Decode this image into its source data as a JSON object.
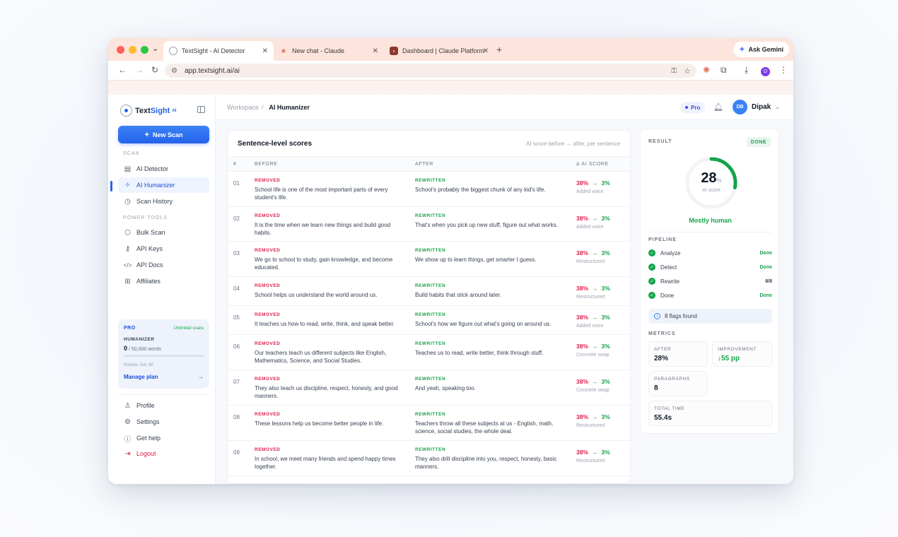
{
  "browser": {
    "tabs": [
      {
        "title": "TextSight - AI Detector",
        "icon": "textsight-icon"
      },
      {
        "title": "New chat - Claude",
        "icon": "claude-icon"
      },
      {
        "title": "Dashboard | Claude Platform",
        "icon": "anthropic-icon"
      }
    ],
    "gemini_label": "Ask Gemini",
    "url": "app.textsight.ai/ai",
    "profile_initial": "D"
  },
  "sidebar": {
    "brand_a": "Text",
    "brand_b": "Sight",
    "brand_tag": "AI",
    "new_scan": "New Scan",
    "scan_section": "SCAN",
    "scan_items": [
      {
        "label": "AI Detector",
        "icon": "document-icon"
      },
      {
        "label": "AI Humanizer",
        "icon": "sparkle-icon"
      },
      {
        "label": "Scan History",
        "icon": "clock-icon"
      }
    ],
    "power_section": "POWER TOOLS",
    "power_items": [
      {
        "label": "Bulk Scan",
        "icon": "cube-icon"
      },
      {
        "label": "API Keys",
        "icon": "key-icon"
      },
      {
        "label": "API Docs",
        "icon": "code-icon"
      },
      {
        "label": "Affiliates",
        "icon": "gift-icon"
      }
    ],
    "plan": {
      "tier": "PRO",
      "unlimited": "Unlimited scans",
      "product": "HUMANIZER",
      "used": "0",
      "limit": "/ 50,000 words",
      "usage_fraction": 0,
      "resets": "Resets Jun 30",
      "manage": "Manage plan"
    },
    "bottom_items": [
      {
        "label": "Profile",
        "icon": "user-icon"
      },
      {
        "label": "Settings",
        "icon": "gear-icon"
      },
      {
        "label": "Get help",
        "icon": "help-icon"
      },
      {
        "label": "Logout",
        "icon": "logout-icon"
      }
    ]
  },
  "header": {
    "crumb_root": "Workspace",
    "crumb_current": "AI Humanizer",
    "plan_badge": "Pro",
    "user_initials": "DB",
    "user_name": "Dipak"
  },
  "table": {
    "title": "Sentence-level scores",
    "subtitle": "AI score before → after, per sentence",
    "columns": [
      "#",
      "BEFORE",
      "AFTER",
      "Δ AI SCORE"
    ],
    "removed_label": "REMOVED",
    "rewritten_label": "REWRITTEN",
    "rows": [
      {
        "n": "01",
        "before": "School life is one of the most important parts of every student's life.",
        "after": "School's probably the biggest chunk of any kid's life.",
        "from": "38%",
        "to": "3%",
        "note": "Added voice"
      },
      {
        "n": "02",
        "before": "It is the time when we learn new things and build good habits.",
        "after": "That's when you pick up new stuff, figure out what works.",
        "from": "38%",
        "to": "3%",
        "note": "Added voice"
      },
      {
        "n": "03",
        "before": "We go to school to study, gain knowledge, and become educated.",
        "after": "We show up to learn things, get smarter I guess.",
        "from": "38%",
        "to": "3%",
        "note": "Restructured"
      },
      {
        "n": "04",
        "before": "School helps us understand the world around us.",
        "after": "Build habits that stick around later.",
        "from": "38%",
        "to": "3%",
        "note": "Restructured"
      },
      {
        "n": "05",
        "before": "It teaches us how to read, write, think, and speak better.",
        "after": "School's how we figure out what's going on around us.",
        "from": "38%",
        "to": "3%",
        "note": "Added voice"
      },
      {
        "n": "06",
        "before": "Our teachers teach us different subjects like English, Mathematics, Science, and Social Studies.",
        "after": "Teaches us to read, write better, think through stuff.",
        "from": "38%",
        "to": "3%",
        "note": "Concrete swap"
      },
      {
        "n": "07",
        "before": "They also teach us discipline, respect, honesty, and good manners.",
        "after": "And yeah, speaking too.",
        "from": "38%",
        "to": "3%",
        "note": "Concrete swap"
      },
      {
        "n": "08",
        "before": "These lessons help us become better people in life.",
        "after": "Teachers throw all these subjects at us - English, math, science, social studies, the whole deal.",
        "from": "38%",
        "to": "3%",
        "note": "Restructured"
      },
      {
        "n": "09",
        "before": "In school, we meet many friends and spend happy times together.",
        "after": "They also drill discipline into you, respect, honesty, basic manners.",
        "from": "38%",
        "to": "3%",
        "note": "Restructured"
      }
    ]
  },
  "result": {
    "title": "RESULT",
    "status": "DONE",
    "score": "28",
    "score_fraction": 0.28,
    "score_unit": "%",
    "score_label": "AI score",
    "verdict": "Mostly human",
    "pipeline_title": "PIPELINE",
    "pipeline": [
      {
        "step": "Analyze",
        "status": "Done"
      },
      {
        "step": "Detect",
        "status": "Done"
      },
      {
        "step": "Rewrite",
        "status": "8/8"
      },
      {
        "step": "Done",
        "status": "Done"
      }
    ],
    "flags": "8 flags found",
    "metrics_title": "METRICS",
    "metrics": {
      "after_label": "AFTER",
      "after_value": "28%",
      "improvement_label": "IMPROVEMENT",
      "improvement_value": "↓55 pp",
      "paragraphs_label": "PARAGRAPHS",
      "paragraphs_value": "8",
      "time_label": "TOTAL TIME",
      "time_value": "55.4s"
    }
  },
  "colors": {
    "accent": "#2563eb",
    "success": "#16a34a",
    "danger": "#e11d48"
  }
}
